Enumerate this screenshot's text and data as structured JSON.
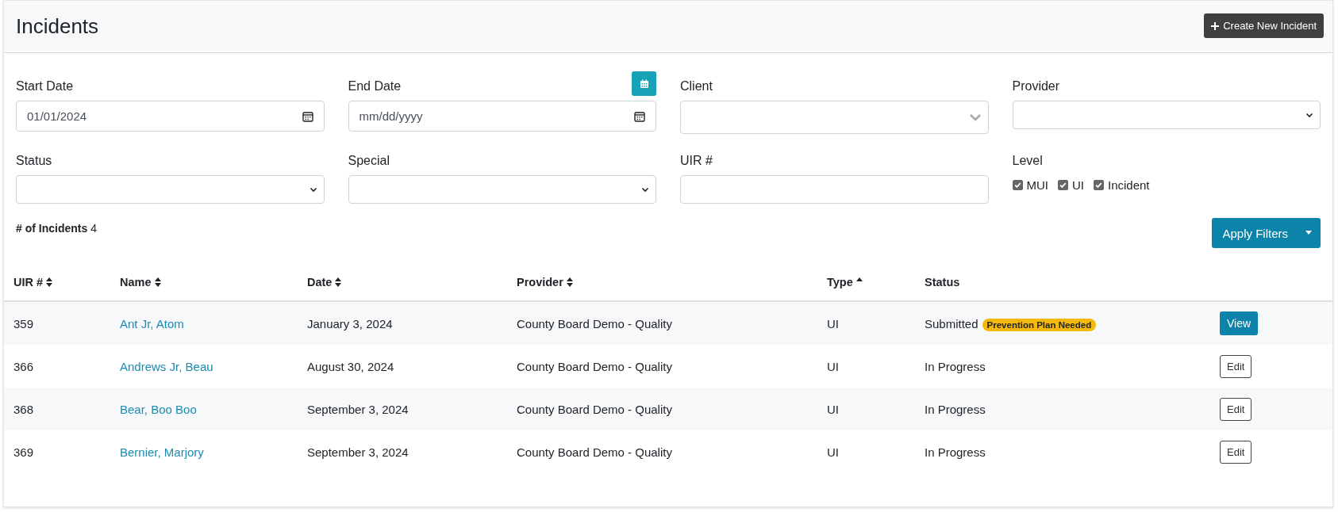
{
  "header": {
    "title": "Incidents",
    "create_button": "Create New Incident"
  },
  "filters": [
    {
      "label": "Start Date",
      "kind": "date",
      "value": "01/01/2024"
    },
    {
      "label": "End Date",
      "kind": "date",
      "placeholder": "mm/dd/yyyy",
      "calendar_button": true
    },
    {
      "label": "Client",
      "kind": "combo"
    },
    {
      "label": "Provider",
      "kind": "select"
    },
    {
      "label": "Status",
      "kind": "select"
    },
    {
      "label": "Special",
      "kind": "select"
    },
    {
      "label": "UIR #",
      "kind": "text"
    },
    {
      "label": "Level",
      "kind": "checks",
      "options": [
        {
          "label": "MUI",
          "checked": true
        },
        {
          "label": "UI",
          "checked": true
        },
        {
          "label": "Incident",
          "checked": true
        }
      ]
    }
  ],
  "count": {
    "label": "# of Incidents",
    "value": "4"
  },
  "apply_button": "Apply Filters",
  "table": {
    "columns": [
      {
        "label": "UIR #",
        "sortable": true,
        "sorted": false
      },
      {
        "label": "Name",
        "sortable": true,
        "sorted": false
      },
      {
        "label": "Date",
        "sortable": true,
        "sorted": false
      },
      {
        "label": "Provider",
        "sortable": true,
        "sorted": false
      },
      {
        "label": "Type",
        "sortable": true,
        "sorted": true
      },
      {
        "label": "Status",
        "sortable": false
      }
    ],
    "rows": [
      {
        "uir": "359",
        "name": "Ant Jr, Atom",
        "date": "January 3, 2024",
        "provider": "County Board Demo - Quality",
        "type": "UI",
        "status": "Submitted",
        "badge": "Prevention Plan Needed",
        "action": {
          "kind": "view",
          "label": "View"
        }
      },
      {
        "uir": "366",
        "name": "Andrews Jr, Beau",
        "date": "August 30, 2024",
        "provider": "County Board Demo - Quality",
        "type": "UI",
        "status": "In Progress",
        "action": {
          "kind": "edit",
          "label": "Edit"
        }
      },
      {
        "uir": "368",
        "name": "Bear, Boo Boo",
        "date": "September 3, 2024",
        "provider": "County Board Demo - Quality",
        "type": "UI",
        "status": "In Progress",
        "action": {
          "kind": "edit",
          "label": "Edit"
        }
      },
      {
        "uir": "369",
        "name": "Bernier, Marjory",
        "date": "September 3, 2024",
        "provider": "County Board Demo - Quality",
        "type": "UI",
        "status": "In Progress",
        "action": {
          "kind": "edit",
          "label": "Edit"
        }
      }
    ]
  }
}
